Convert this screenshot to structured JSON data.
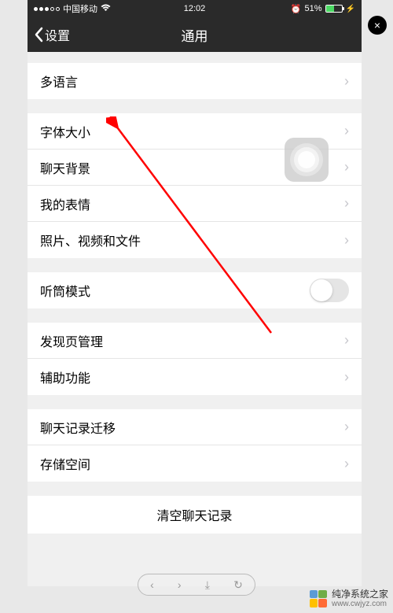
{
  "status_bar": {
    "carrier": "中国移动",
    "wifi_icon": "wifi-icon",
    "time": "12:02",
    "battery_percent": "51%",
    "alarm_icon": "alarm-icon"
  },
  "nav": {
    "back_label": "设置",
    "title": "通用"
  },
  "sections": [
    {
      "rows": [
        {
          "key": "language",
          "label": "多语言",
          "type": "chevron"
        }
      ]
    },
    {
      "rows": [
        {
          "key": "font-size",
          "label": "字体大小",
          "type": "chevron"
        },
        {
          "key": "chat-bg",
          "label": "聊天背景",
          "type": "chevron"
        },
        {
          "key": "stickers",
          "label": "我的表情",
          "type": "chevron"
        },
        {
          "key": "media-files",
          "label": "照片、视频和文件",
          "type": "chevron"
        }
      ]
    },
    {
      "rows": [
        {
          "key": "earpiece-mode",
          "label": "听筒模式",
          "type": "toggle",
          "value": false
        }
      ]
    },
    {
      "rows": [
        {
          "key": "discover-manage",
          "label": "发现页管理",
          "type": "chevron"
        },
        {
          "key": "accessibility",
          "label": "辅助功能",
          "type": "chevron"
        }
      ]
    },
    {
      "rows": [
        {
          "key": "chat-migrate",
          "label": "聊天记录迁移",
          "type": "chevron"
        },
        {
          "key": "storage",
          "label": "存储空间",
          "type": "chevron"
        }
      ]
    }
  ],
  "clear_button": {
    "label": "清空聊天记录"
  },
  "annotation": {
    "target": "font-size",
    "color": "#ff0000"
  },
  "watermark": {
    "name": "纯净系统之家",
    "url": "www.cwjyz.com"
  },
  "overlay": {
    "close_icon": "×"
  }
}
